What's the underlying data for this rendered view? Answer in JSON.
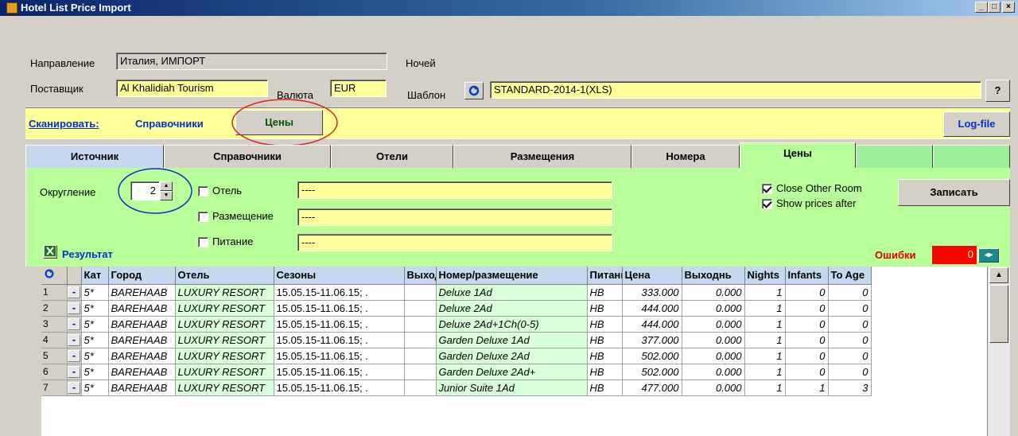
{
  "window": {
    "title": "Hotel List Price Import",
    "controls": [
      "_",
      "□",
      "×"
    ]
  },
  "header": {
    "direction_label": "Направление",
    "direction_value": "Италия, ИМПОРТ",
    "nights_label": "Ночей",
    "supplier_label": "Поставщик",
    "supplier_value": "Al Khalidiah Tourism",
    "currency_label": "Валюта",
    "currency_value": "EUR",
    "template_label": "Шаблон",
    "template_value": "STANDARD-2014-1(XLS)",
    "help_label": "?"
  },
  "scanbar": {
    "scan_label": "Сканировать:",
    "refs_label": "Справочники",
    "prices_label": "Цены",
    "logfile_label": "Log-file"
  },
  "tabs": [
    {
      "label": "Источник"
    },
    {
      "label": "Справочники"
    },
    {
      "label": "Отели"
    },
    {
      "label": "Размещения"
    },
    {
      "label": "Номера"
    },
    {
      "label": "Цены"
    },
    {
      "label": ""
    },
    {
      "label": ""
    }
  ],
  "options": {
    "rounding_label": "Округление",
    "rounding_value": "2",
    "hotel_label": "Отель",
    "hotel_value": "----",
    "accommodation_label": "Размещение",
    "accommodation_value": "----",
    "meal_label": "Питание",
    "meal_value": "----",
    "close_other_room_label": "Close Other Room",
    "show_prices_after_label": "Show prices after",
    "save_label": "Записать"
  },
  "result": {
    "label": "Результат",
    "errors_label": "Ошибки",
    "errors_value": "0"
  },
  "colors": {
    "panel_green": "#b8ff99",
    "field_yellow": "#ffff99",
    "header_blue": "#c6d8f0",
    "error_red": "#ff0000"
  },
  "table": {
    "columns": [
      "Кат",
      "Город",
      "Отель",
      "Сезоны",
      "Выходн",
      "Номер/размещение",
      "Питание",
      "Цена",
      "Выходнь",
      "Nights",
      "Infants",
      "To Age"
    ],
    "rows": [
      {
        "n": "1",
        "cat": "5*",
        "city": "BAREHAAB",
        "hotel": "LUXURY RESORT",
        "season": "15.05.15-11.06.15; .",
        "wk": "",
        "room": "Deluxe 1Ad",
        "meal": "HB",
        "price": "333.000",
        "wkp": "0.000",
        "nights": "1",
        "infants": "0",
        "toage": "0"
      },
      {
        "n": "2",
        "cat": "5*",
        "city": "BAREHAAB",
        "hotel": "LUXURY RESORT",
        "season": "15.05.15-11.06.15; .",
        "wk": "",
        "room": "Deluxe 2Ad",
        "meal": "HB",
        "price": "444.000",
        "wkp": "0.000",
        "nights": "1",
        "infants": "0",
        "toage": "0"
      },
      {
        "n": "3",
        "cat": "5*",
        "city": "BAREHAAB",
        "hotel": "LUXURY RESORT",
        "season": "15.05.15-11.06.15; .",
        "wk": "",
        "room": "Deluxe 2Ad+1Ch(0-5)",
        "meal": "HB",
        "price": "444.000",
        "wkp": "0.000",
        "nights": "1",
        "infants": "0",
        "toage": "0"
      },
      {
        "n": "4",
        "cat": "5*",
        "city": "BAREHAAB",
        "hotel": "LUXURY RESORT",
        "season": "15.05.15-11.06.15; .",
        "wk": "",
        "room": "Garden Deluxe 1Ad",
        "meal": "HB",
        "price": "377.000",
        "wkp": "0.000",
        "nights": "1",
        "infants": "0",
        "toage": "0"
      },
      {
        "n": "5",
        "cat": "5*",
        "city": "BAREHAAB",
        "hotel": "LUXURY RESORT",
        "season": "15.05.15-11.06.15; .",
        "wk": "",
        "room": "Garden Deluxe 2Ad",
        "meal": "HB",
        "price": "502.000",
        "wkp": "0.000",
        "nights": "1",
        "infants": "0",
        "toage": "0"
      },
      {
        "n": "6",
        "cat": "5*",
        "city": "BAREHAAB",
        "hotel": "LUXURY RESORT",
        "season": "15.05.15-11.06.15; .",
        "wk": "",
        "room": "Garden Deluxe 2Ad+",
        "meal": "HB",
        "price": "502.000",
        "wkp": "0.000",
        "nights": "1",
        "infants": "0",
        "toage": "0"
      },
      {
        "n": "7",
        "cat": "5*",
        "city": "BAREHAAB",
        "hotel": "LUXURY RESORT",
        "season": "15.05.15-11.06.15; .",
        "wk": "",
        "room": "Junior Suite 1Ad",
        "meal": "HB",
        "price": "477.000",
        "wkp": "0.000",
        "nights": "1",
        "infants": "1",
        "toage": "3"
      }
    ]
  }
}
